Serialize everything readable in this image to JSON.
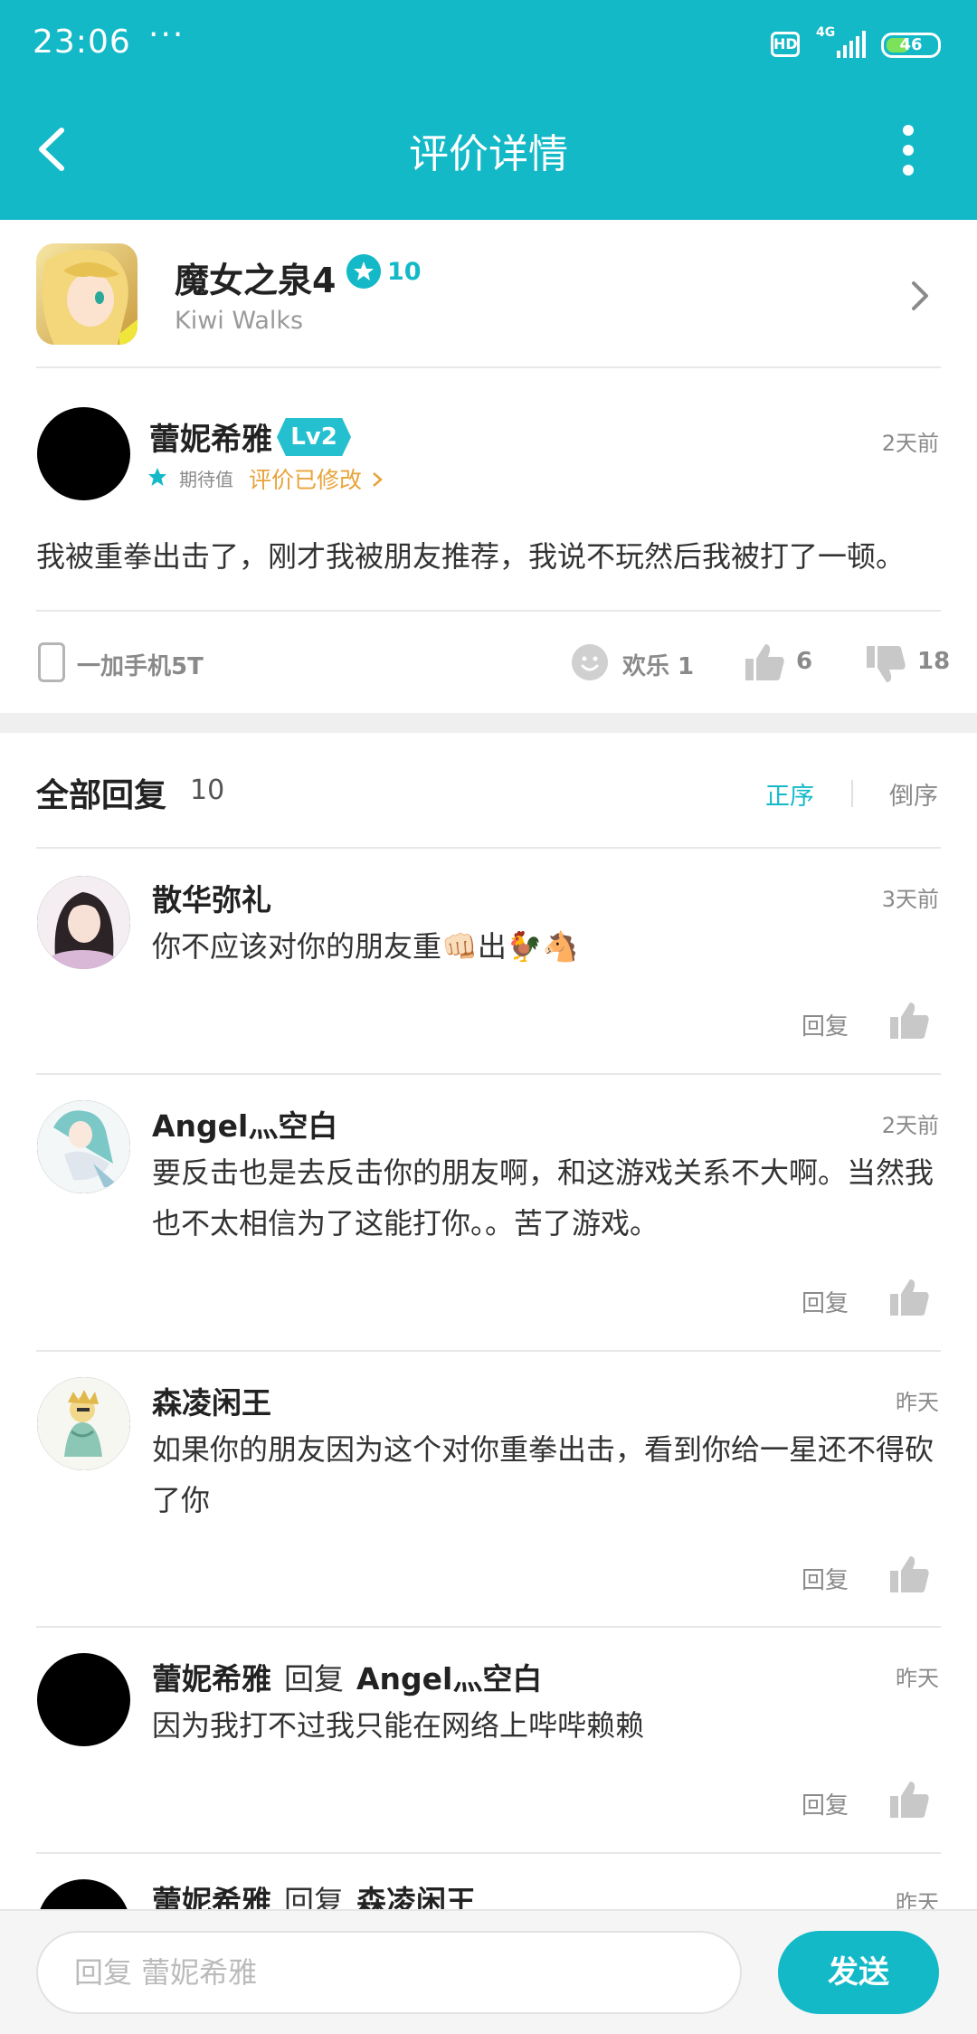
{
  "status_bar": {
    "time": "23:06",
    "dots": "···",
    "hd": "HD",
    "network": "4G",
    "battery": "46",
    "battery_level": 0.46
  },
  "header": {
    "title": "评价详情"
  },
  "game": {
    "title": "魔女之泉4",
    "score": "10",
    "developer": "Kiwi Walks"
  },
  "review": {
    "author": "蕾妮希雅",
    "level": "Lv2",
    "time": "2天前",
    "expect_label": "期待值",
    "edited_label": "评价已修改",
    "text": "我被重拳出击了，刚才我被朋友推荐，我说不玩然后我被打了一顿。",
    "device": "一加手机5T",
    "emoji_label": "欢乐 1",
    "upvotes": "6",
    "downvotes": "18"
  },
  "replies_header": {
    "title": "全部回复",
    "count": "10",
    "sort_asc": "正序",
    "sort_desc": "倒序"
  },
  "replies": [
    {
      "name": "散华弥礼",
      "time": "3天前",
      "text": "你不应该对你的朋友重👊🏻出🐓🐴",
      "action": "回复"
    },
    {
      "name": "Angel灬空白",
      "time": "2天前",
      "text": "要反击也是去反击你的朋友啊，和这游戏关系不大啊。当然我也不太相信为了这能打你。。苦了游戏。",
      "action": "回复"
    },
    {
      "name": "森凌闲王",
      "time": "昨天",
      "text": "如果你的朋友因为这个对你重拳出击，看到你给一星还不得砍了你",
      "action": "回复"
    },
    {
      "name": "蕾妮希雅",
      "reply_word": "回复",
      "reply_to": "Angel灬空白",
      "time": "昨天",
      "text": "因为我打不过我只能在网络上哔哔赖赖",
      "action": "回复"
    },
    {
      "name": "蕾妮希雅",
      "reply_word": "回复",
      "reply_to": "森凌闲王",
      "time": "昨天"
    }
  ],
  "composer": {
    "placeholder": "回复 蕾妮希雅",
    "send_label": "发送"
  },
  "colors": {
    "brand": "#14B9C8",
    "edited": "#E8A33A"
  }
}
